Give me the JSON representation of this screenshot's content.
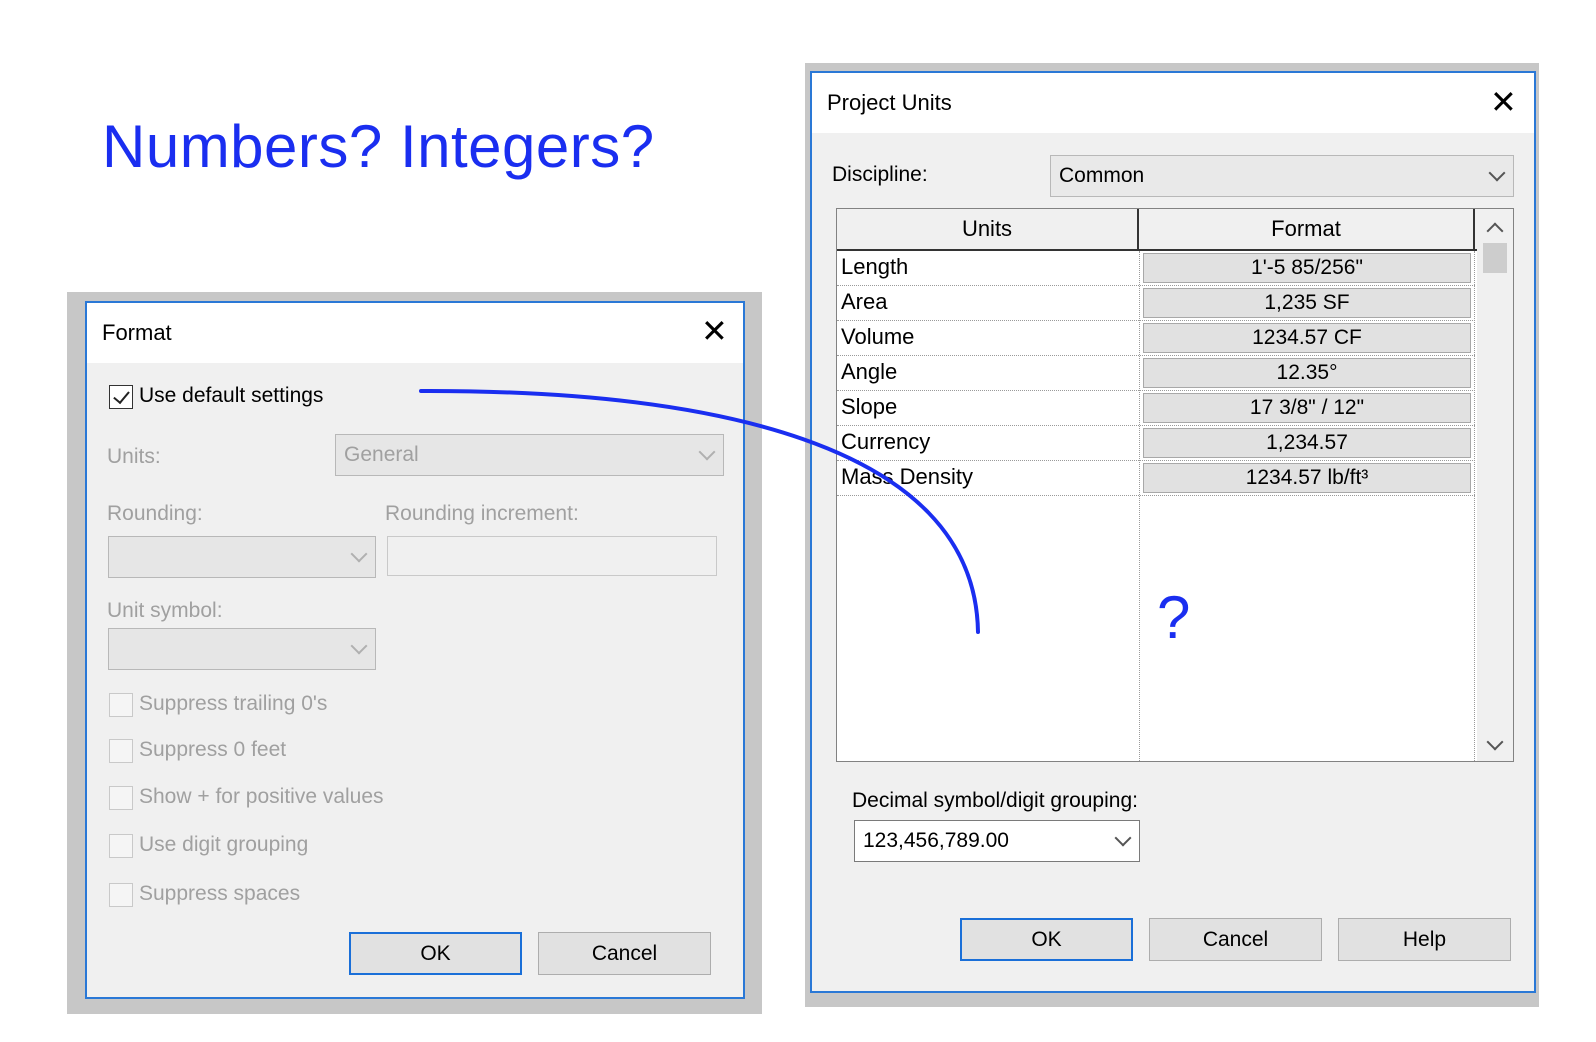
{
  "slide": {
    "title": "Numbers? Integers?",
    "annotation_mark": "?"
  },
  "format_dialog": {
    "title": "Format",
    "use_default": {
      "label": "Use default settings",
      "checked": true
    },
    "units_label": "Units:",
    "units_value": "General",
    "rounding_label": "Rounding:",
    "rounding_value": "",
    "rounding_increment_label": "Rounding increment:",
    "rounding_increment_value": "",
    "unit_symbol_label": "Unit symbol:",
    "unit_symbol_value": "",
    "options": [
      {
        "label": "Suppress trailing 0's",
        "checked": false
      },
      {
        "label": "Suppress 0 feet",
        "checked": false
      },
      {
        "label": "Show + for positive values",
        "checked": false
      },
      {
        "label": "Use digit grouping",
        "checked": false
      },
      {
        "label": "Suppress spaces",
        "checked": false
      }
    ],
    "ok_label": "OK",
    "cancel_label": "Cancel"
  },
  "project_units": {
    "title": "Project Units",
    "discipline_label": "Discipline:",
    "discipline_value": "Common",
    "table": {
      "headers": [
        "Units",
        "Format"
      ],
      "rows": [
        {
          "unit": "Length",
          "format": "1'-5 85/256\""
        },
        {
          "unit": "Area",
          "format": "1,235 SF"
        },
        {
          "unit": "Volume",
          "format": "1234.57 CF"
        },
        {
          "unit": "Angle",
          "format": "12.35°"
        },
        {
          "unit": "Slope",
          "format": "17 3/8\" / 12\""
        },
        {
          "unit": "Currency",
          "format": "1,234.57"
        },
        {
          "unit": "Mass Density",
          "format": "1234.57 lb/ft³"
        }
      ]
    },
    "decimal_label": "Decimal symbol/digit grouping:",
    "decimal_value": "123,456,789.00",
    "ok_label": "OK",
    "cancel_label": "Cancel",
    "help_label": "Help"
  },
  "colors": {
    "annotation_blue": "#1a2ef0",
    "default_button_border": "#1a6fd8"
  },
  "icons": [
    "close-icon",
    "checkbox-checked-icon",
    "chevron-down-icon",
    "scroll-up-icon",
    "scroll-down-icon"
  ]
}
